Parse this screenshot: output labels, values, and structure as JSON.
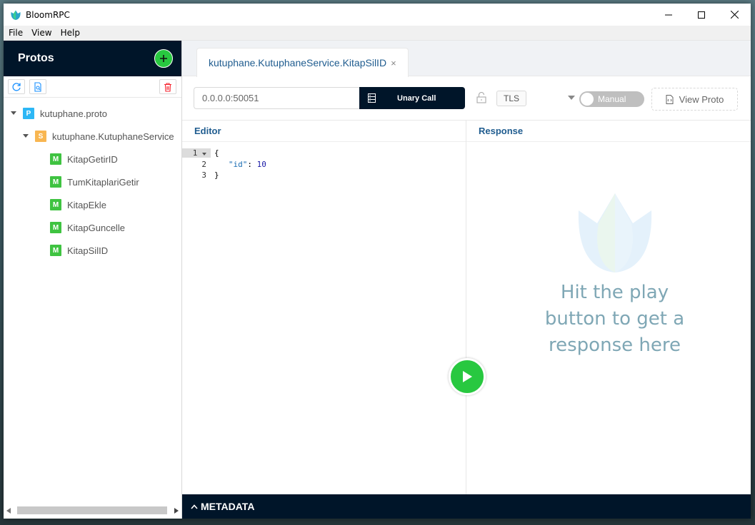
{
  "window": {
    "title": "BloomRPC"
  },
  "menu": [
    "File",
    "View",
    "Help"
  ],
  "sidebar": {
    "title": "Protos",
    "tree": [
      {
        "badge": "P",
        "label": "kutuphane.proto"
      },
      {
        "badge": "S",
        "label": "kutuphane.KutuphaneService"
      },
      {
        "badge": "M",
        "label": "KitapGetirID"
      },
      {
        "badge": "M",
        "label": "TumKitaplariGetir"
      },
      {
        "badge": "M",
        "label": "KitapEkle"
      },
      {
        "badge": "M",
        "label": "KitapGuncelle"
      },
      {
        "badge": "M",
        "label": "KitapSilID"
      }
    ]
  },
  "tab": {
    "label": "kutuphane.KutuphaneService.KitapSilID",
    "close": "×"
  },
  "request": {
    "address_value": "0.0.0.0:50051",
    "call_type": "Unary Call",
    "tls": "TLS",
    "toggle_label": "Manual",
    "view_proto": "View Proto"
  },
  "editor": {
    "title": "Editor",
    "lines": [
      {
        "num": "1",
        "text": "{"
      },
      {
        "num": "2",
        "key": "\"id\"",
        "value": "10"
      },
      {
        "num": "3",
        "text": "}"
      }
    ]
  },
  "response": {
    "title": "Response",
    "hint_line1": "Hit the play",
    "hint_line2": "button to get a",
    "hint_line3": "response here"
  },
  "metadata": {
    "label": "METADATA"
  },
  "colors": {
    "navy": "#001529",
    "green": "#28c840",
    "accent_text": "#1f5c8f",
    "hint": "#7fa7b5"
  }
}
